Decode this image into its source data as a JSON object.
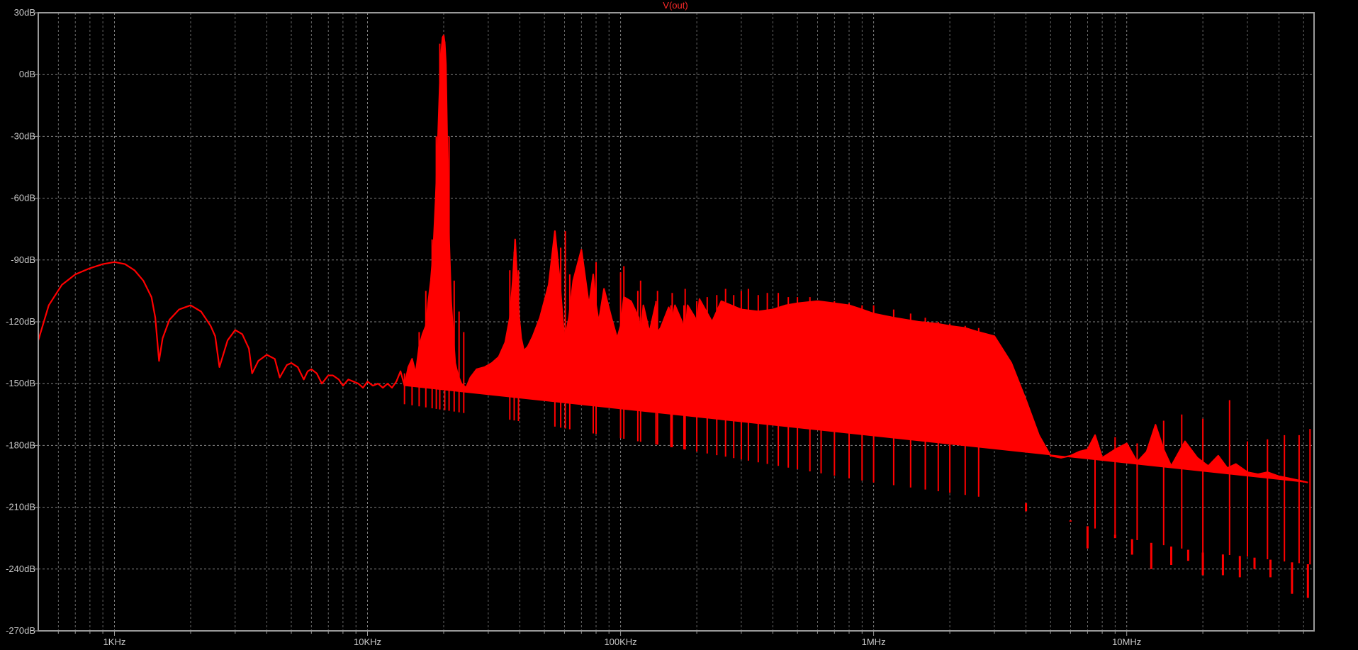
{
  "chart_data": {
    "type": "line",
    "title": "V(out)",
    "xlabel": "",
    "ylabel": "",
    "x_scale": "log",
    "xlim": [
      500,
      55000000
    ],
    "ylim": [
      -270,
      30
    ],
    "grid": true,
    "colors": {
      "background": "#000000",
      "frame": "#9a9a9a",
      "grid": "#808080",
      "series": "#ff0000",
      "title": "#ff2a2a",
      "tick_text": "#c8c8c8"
    },
    "x_ticks": [
      {
        "value": 1000,
        "label": "1KHz"
      },
      {
        "value": 10000,
        "label": "10KHz"
      },
      {
        "value": 100000,
        "label": "100KHz"
      },
      {
        "value": 1000000,
        "label": "1MHz"
      },
      {
        "value": 10000000,
        "label": "10MHz"
      }
    ],
    "y_ticks": [
      {
        "value": 30,
        "label": "30dB"
      },
      {
        "value": 0,
        "label": "0dB"
      },
      {
        "value": -30,
        "label": "-30dB"
      },
      {
        "value": -60,
        "label": "-60dB"
      },
      {
        "value": -90,
        "label": "-90dB"
      },
      {
        "value": -120,
        "label": "-120dB"
      },
      {
        "value": -150,
        "label": "-150dB"
      },
      {
        "value": -180,
        "label": "-180dB"
      },
      {
        "value": -210,
        "label": "-210dB"
      },
      {
        "value": -240,
        "label": "-240dB"
      },
      {
        "value": -270,
        "label": "-270dB"
      }
    ],
    "series": [
      {
        "name": "V(out)",
        "line": {
          "x": [
            500,
            550,
            620,
            700,
            800,
            900,
            1000,
            1100,
            1200,
            1300,
            1400,
            1450,
            1500,
            1550,
            1650,
            1800,
            2000,
            2200,
            2400,
            2500,
            2600,
            2800,
            3000,
            3200,
            3400,
            3500,
            3700,
            4000,
            4300,
            4500,
            4800,
            5000,
            5300,
            5600,
            5800,
            6000,
            6300,
            6600,
            7000,
            7300,
            7700,
            8000,
            8400,
            8800,
            9200,
            9600,
            10000,
            10500,
            11000,
            11500,
            12000,
            12500,
            13000,
            13500,
            14000,
            14500,
            15000,
            15500,
            16000,
            16500,
            17000,
            17400,
            17800,
            18200,
            18600,
            19000,
            19300,
            19600,
            19800,
            20000,
            20200,
            20400,
            20700,
            21000,
            21400,
            21800,
            22200,
            22800,
            23500,
            24500,
            25500,
            27000,
            29000,
            31000,
            33000,
            35000,
            36500,
            37500,
            38300,
            39000,
            39700,
            40500,
            41500,
            43000,
            45000,
            48000,
            52000,
            55000,
            57500,
            59000,
            60000,
            61000,
            62500,
            65000,
            70000,
            75000,
            78000,
            80000,
            82000,
            86000,
            92000,
            97000,
            100000,
            103000,
            110000,
            118000,
            120000,
            123000,
            130000,
            138000,
            140000,
            144000,
            155000,
            160000,
            164000,
            175000,
            180000,
            184000,
            197000,
            200000,
            205000,
            230000,
            250000,
            300000,
            350000,
            400000,
            450000,
            500000,
            600000,
            700000,
            800000,
            900000,
            1000000,
            1200000,
            1500000,
            1800000,
            2000000,
            2300000,
            2600000,
            3000000,
            3500000,
            4000000,
            4500000,
            5000000,
            5500000,
            6000000,
            6500000,
            7000000,
            7500000,
            8000000,
            9000000,
            10000000,
            11000000,
            12000000,
            13000000,
            14000000,
            15000000,
            17000000,
            19000000,
            21000000,
            23000000,
            25000000,
            27000000,
            30000000,
            33000000,
            36000000,
            40000000,
            44000000,
            48000000,
            52000000,
            55000000
          ],
          "y": [
            -129,
            -112,
            -102,
            -97,
            -94,
            -92,
            -91,
            -92,
            -95,
            -100,
            -108,
            -118,
            -139,
            -128,
            -119,
            -114,
            -112,
            -115,
            -122,
            -127,
            -142,
            -129,
            -124,
            -126,
            -133,
            -145,
            -139,
            -136,
            -138,
            -147,
            -141,
            -140,
            -142,
            -148,
            -144,
            -143,
            -145,
            -150,
            -146,
            -146,
            -148,
            -151,
            -148,
            -149,
            -150,
            -152,
            -149,
            -151,
            -150,
            -152,
            -150,
            -152,
            -149,
            -144,
            -151,
            -142,
            -138,
            -145,
            -132,
            -126,
            -122,
            -110,
            -100,
            -85,
            -60,
            -30,
            -5,
            12,
            18,
            19,
            15,
            5,
            -40,
            -80,
            -110,
            -126,
            -140,
            -146,
            -150,
            -152,
            -147,
            -143,
            -142,
            -140,
            -137,
            -130,
            -118,
            -100,
            -80,
            -100,
            -117,
            -128,
            -134,
            -132,
            -127,
            -118,
            -102,
            -76,
            -100,
            -118,
            -128,
            -125,
            -118,
            -100,
            -85,
            -112,
            -97,
            -112,
            -120,
            -104,
            -118,
            -128,
            -122,
            -108,
            -110,
            -118,
            -129,
            -112,
            -125,
            -111,
            -125,
            -123,
            -113,
            -120,
            -112,
            -120,
            -128,
            -112,
            -118,
            -123,
            -109,
            -120,
            -110,
            -114,
            -115,
            -114,
            -112,
            -111,
            -110,
            -111,
            -112,
            -114,
            -116,
            -118,
            -120,
            -121,
            -122,
            -123,
            -125,
            -127,
            -140,
            -158,
            -175,
            -185,
            -186,
            -185,
            -183,
            -182,
            -175,
            -186,
            -182,
            -179,
            -188,
            -183,
            -170,
            -182,
            -190,
            -178,
            -186,
            -190,
            -185,
            -191,
            -189,
            -193,
            -194,
            -193,
            -195,
            -196,
            -197,
            -198
          ]
        },
        "floor": {
          "x": [
            14000,
            50000,
            200000,
            1000000,
            4000000,
            6500000,
            10000000,
            20000000,
            30000000,
            40000000,
            55000000
          ],
          "y": [
            -160,
            -170,
            -183,
            -198,
            -208,
            -218,
            -225,
            -232,
            -234,
            -236,
            -238
          ]
        },
        "spikes": [
          {
            "x": 14000,
            "y": -145
          },
          {
            "x": 15000,
            "y": -138
          },
          {
            "x": 16000,
            "y": -125
          },
          {
            "x": 17000,
            "y": -105
          },
          {
            "x": 18000,
            "y": -80
          },
          {
            "x": 18700,
            "y": -30
          },
          {
            "x": 19300,
            "y": 15
          },
          {
            "x": 20200,
            "y": 16
          },
          {
            "x": 21000,
            "y": -30
          },
          {
            "x": 22000,
            "y": -100
          },
          {
            "x": 23000,
            "y": -115
          },
          {
            "x": 24000,
            "y": -125
          },
          {
            "x": 36500,
            "y": -95
          },
          {
            "x": 38000,
            "y": -86
          },
          {
            "x": 39500,
            "y": -95
          },
          {
            "x": 55000,
            "y": -103
          },
          {
            "x": 58000,
            "y": -84
          },
          {
            "x": 60500,
            "y": -76
          },
          {
            "x": 63000,
            "y": -97
          },
          {
            "x": 78000,
            "y": -97
          },
          {
            "x": 80000,
            "y": -91
          },
          {
            "x": 100000,
            "y": -96
          },
          {
            "x": 103000,
            "y": -93
          },
          {
            "x": 117000,
            "y": -105
          },
          {
            "x": 120000,
            "y": -100
          },
          {
            "x": 138000,
            "y": -110
          },
          {
            "x": 140000,
            "y": -105
          },
          {
            "x": 158000,
            "y": -112
          },
          {
            "x": 160000,
            "y": -106
          },
          {
            "x": 178000,
            "y": -112
          },
          {
            "x": 180000,
            "y": -104
          },
          {
            "x": 200000,
            "y": -110
          },
          {
            "x": 220000,
            "y": -108
          },
          {
            "x": 240000,
            "y": -107
          },
          {
            "x": 260000,
            "y": -104
          },
          {
            "x": 280000,
            "y": -107
          },
          {
            "x": 300000,
            "y": -105
          },
          {
            "x": 320000,
            "y": -104
          },
          {
            "x": 350000,
            "y": -107
          },
          {
            "x": 380000,
            "y": -106
          },
          {
            "x": 420000,
            "y": -106
          },
          {
            "x": 460000,
            "y": -108
          },
          {
            "x": 500000,
            "y": -108
          },
          {
            "x": 560000,
            "y": -108
          },
          {
            "x": 620000,
            "y": -110
          },
          {
            "x": 700000,
            "y": -110
          },
          {
            "x": 800000,
            "y": -111
          },
          {
            "x": 900000,
            "y": -112
          },
          {
            "x": 1000000,
            "y": -112
          },
          {
            "x": 1200000,
            "y": -114
          },
          {
            "x": 1400000,
            "y": -116
          },
          {
            "x": 1600000,
            "y": -118
          },
          {
            "x": 1800000,
            "y": -120
          },
          {
            "x": 2000000,
            "y": -121
          },
          {
            "x": 2300000,
            "y": -122
          },
          {
            "x": 2600000,
            "y": -123
          },
          {
            "x": 7500000,
            "y": -179
          },
          {
            "x": 9000000,
            "y": -176
          },
          {
            "x": 11000000,
            "y": -179
          },
          {
            "x": 14000000,
            "y": -168
          },
          {
            "x": 16500000,
            "y": -165
          },
          {
            "x": 20000000,
            "y": -167
          },
          {
            "x": 25500000,
            "y": -158
          },
          {
            "x": 30000000,
            "y": -178
          },
          {
            "x": 36000000,
            "y": -177
          },
          {
            "x": 42000000,
            "y": -175
          },
          {
            "x": 48000000,
            "y": -175
          },
          {
            "x": 53000000,
            "y": -172
          }
        ],
        "dips": [
          {
            "x": 4000000,
            "y": -212
          },
          {
            "x": 6000000,
            "y": -217
          },
          {
            "x": 7000000,
            "y": -230
          },
          {
            "x": 9000000,
            "y": -225
          },
          {
            "x": 10500000,
            "y": -233
          },
          {
            "x": 12500000,
            "y": -240
          },
          {
            "x": 15000000,
            "y": -238
          },
          {
            "x": 17500000,
            "y": -236
          },
          {
            "x": 20000000,
            "y": -243
          },
          {
            "x": 24000000,
            "y": -243
          },
          {
            "x": 28000000,
            "y": -244
          },
          {
            "x": 32000000,
            "y": -240
          },
          {
            "x": 37000000,
            "y": -244
          },
          {
            "x": 45000000,
            "y": -252
          },
          {
            "x": 52000000,
            "y": -254
          }
        ]
      }
    ]
  }
}
